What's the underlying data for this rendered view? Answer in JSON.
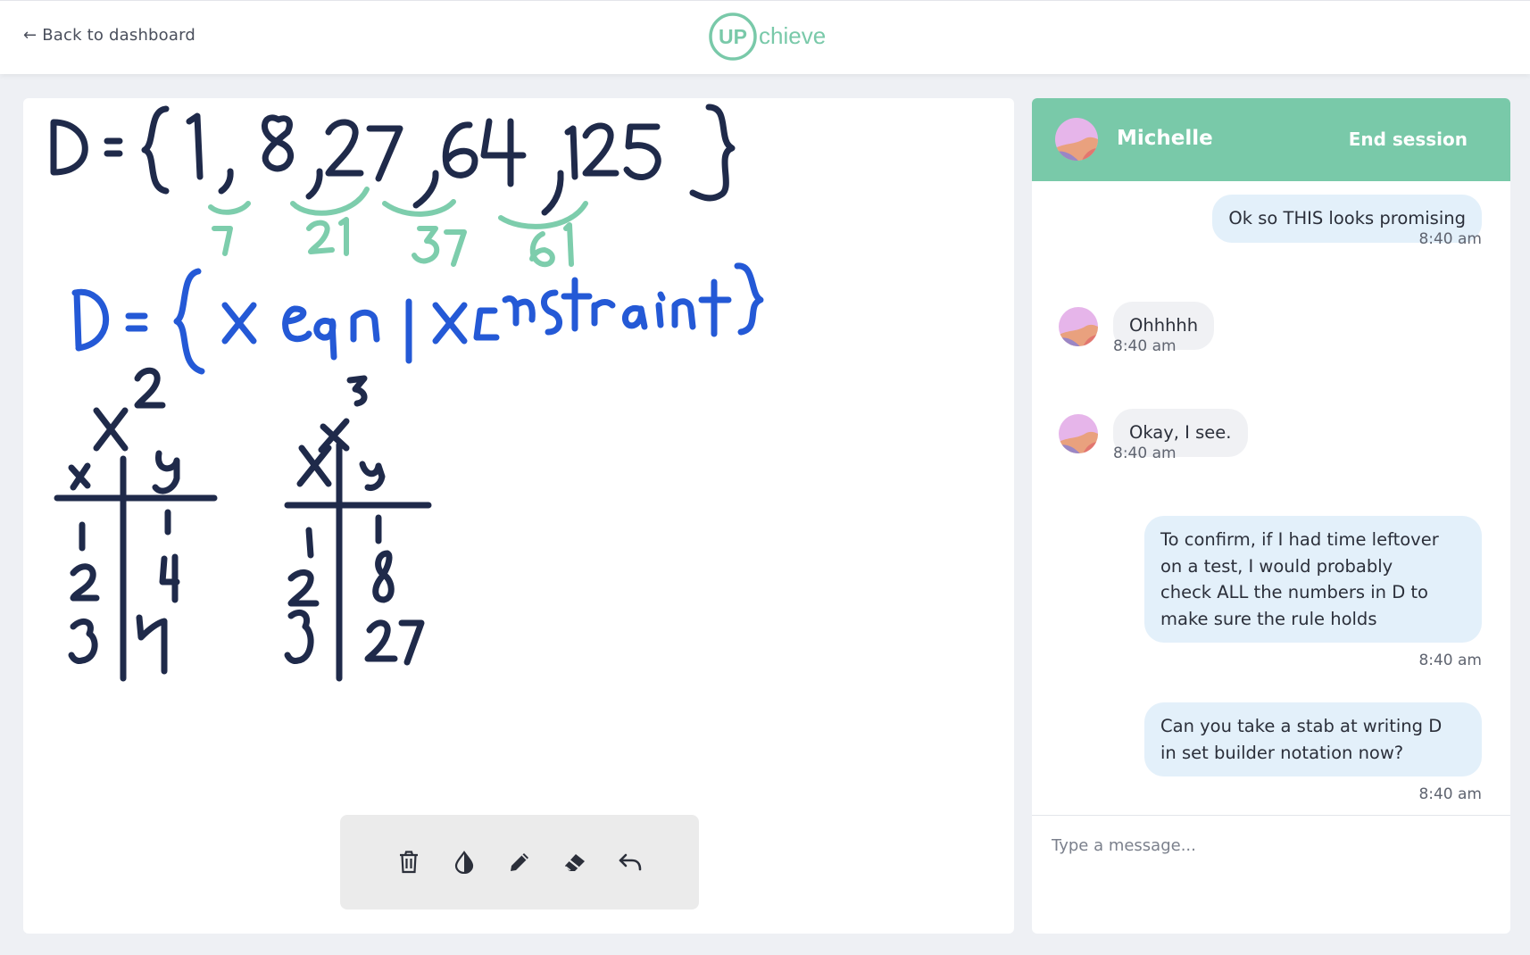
{
  "app": {
    "name": "UPchieve"
  },
  "header": {
    "back_label": "← Back to dashboard",
    "logo_up": "UP",
    "logo_rest": "chieve"
  },
  "colors": {
    "accent": "#79c9a9",
    "ink_dark": "#1f2a4a",
    "ink_green": "#7dcdac",
    "ink_blue": "#2459d6",
    "bubble_mine": "#e3f0fa",
    "bubble_theirs": "#f0f1f4"
  },
  "whiteboard": {
    "tools": [
      {
        "name": "trash-icon",
        "action": "clear"
      },
      {
        "name": "color-picker-icon",
        "action": "color"
      },
      {
        "name": "pencil-icon",
        "action": "draw"
      },
      {
        "name": "eraser-icon",
        "action": "erase"
      },
      {
        "name": "undo-icon",
        "action": "undo"
      }
    ]
  },
  "chat": {
    "partner_name": "Michelle",
    "end_session_label": "End session",
    "messages": [
      {
        "sender": "me",
        "text": "Ok so THIS looks promising",
        "time": "8:40 am"
      },
      {
        "sender": "them",
        "text": "Ohhhhh",
        "time": "8:40 am"
      },
      {
        "sender": "them",
        "text": "Okay, I see.",
        "time": "8:40 am"
      },
      {
        "sender": "me",
        "lines": [
          "To confirm, if I had time leftover",
          "on a test, I would probably",
          "check ALL the numbers in D to",
          "make sure the rule holds"
        ],
        "time": "8:40 am"
      },
      {
        "sender": "me",
        "lines": [
          "Can you take a stab at writing D",
          "in set builder notation now?"
        ],
        "time": "8:40 am"
      }
    ],
    "composer": {
      "placeholder": "Type a message...",
      "value": ""
    }
  }
}
